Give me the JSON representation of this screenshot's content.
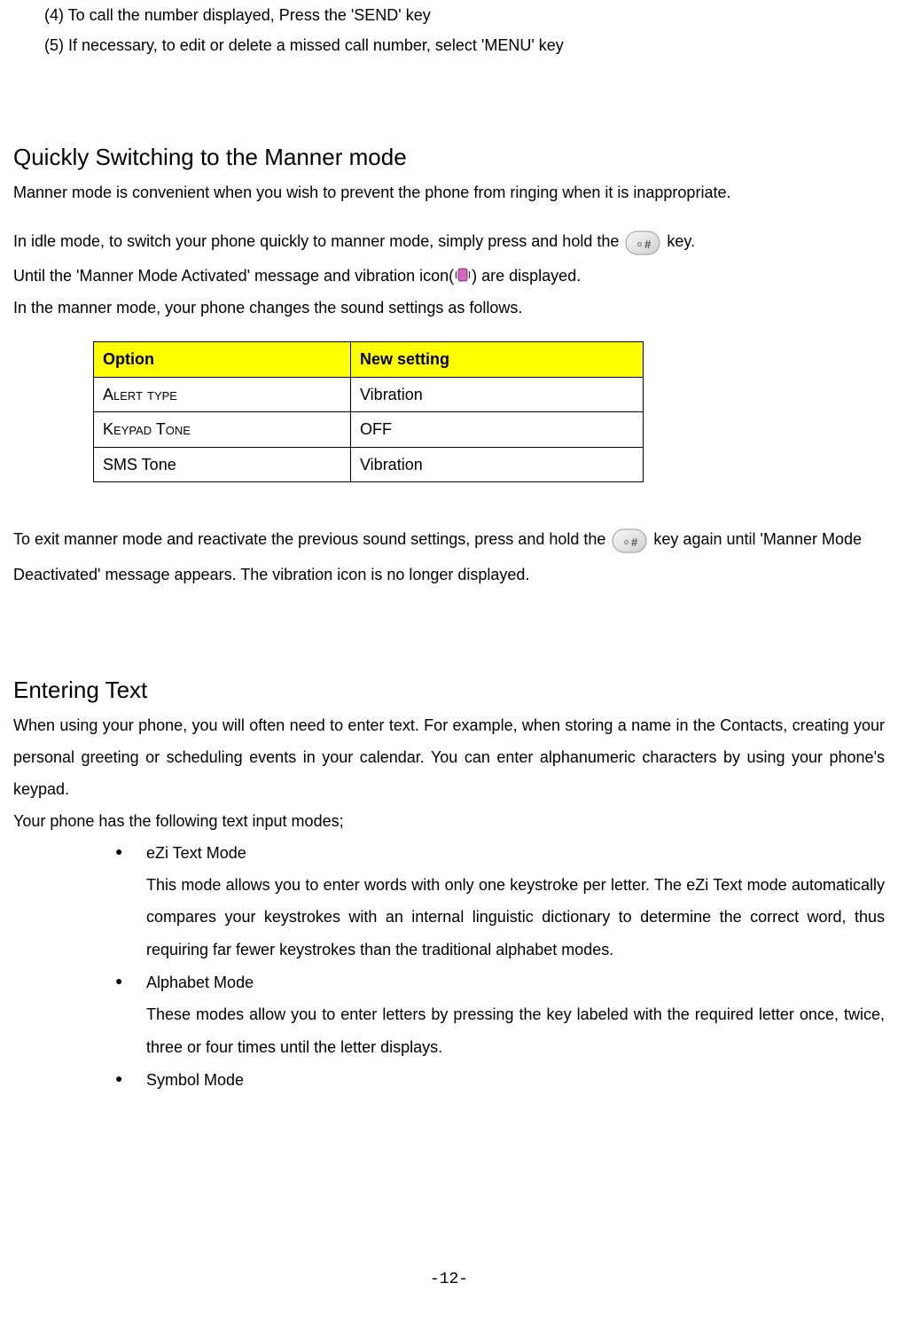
{
  "numbered": {
    "item4": "(4) To call the number displayed, Press the 'SEND' key",
    "item5": "(5) If necessary, to edit or delete a missed call number, select 'MENU' key"
  },
  "section1": {
    "heading": "Quickly Switching to the Manner mode",
    "p1": "Manner mode is convenient when you wish to prevent the phone from ringing when it is inappropriate.",
    "p2_before": "In idle mode, to switch your phone quickly to manner mode, simply press and hold the ",
    "p2_after": " key.",
    "p3_before": "Until the 'Manner Mode Activated' message and vibration icon(",
    "p3_after": ") are displayed.",
    "p4": "In the manner mode, your phone changes the sound settings as follows."
  },
  "table": {
    "header": {
      "col1": "Option",
      "col2": "New setting"
    },
    "rows": [
      {
        "option": "Alert type",
        "setting": "Vibration"
      },
      {
        "option": "Keypad Tone",
        "setting": "OFF"
      },
      {
        "option_plain": "SMS Tone",
        "setting": "Vibration"
      }
    ]
  },
  "section1b": {
    "p5_before": "To exit manner mode and reactivate the previous sound settings, press and hold the ",
    "p5_after": "  key again until 'Manner Mode Deactivated' message appears. The vibration icon is no longer displayed."
  },
  "section2": {
    "heading": "Entering Text",
    "p1": "When using your phone, you will often need to enter text. For example, when storing a name in the Contacts, creating your personal greeting or scheduling events in your calendar. You can enter alphanumeric characters by using your phone's keypad.",
    "p2": "Your phone has the following text input modes;",
    "bullets": [
      {
        "title": "eZi Text Mode",
        "desc": "This mode allows you to enter words with only one keystroke per letter. The eZi Text mode automatically compares your keystrokes with an internal linguistic dictionary to determine the correct word, thus requiring far fewer keystrokes than the traditional alphabet modes."
      },
      {
        "title": "Alphabet Mode",
        "desc": "These modes allow you to enter letters by pressing the key labeled with the required letter once, twice, three or four times until the letter displays."
      },
      {
        "title": "Symbol Mode",
        "desc": ""
      }
    ]
  },
  "pageNumber": "-12-"
}
